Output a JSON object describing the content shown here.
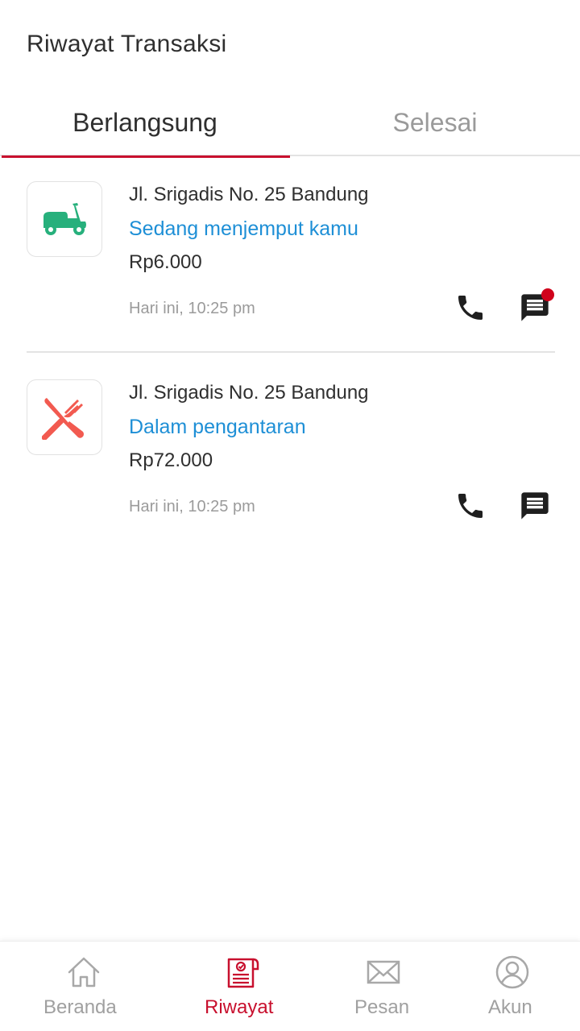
{
  "header": {
    "title": "Riwayat Transaksi"
  },
  "tabs": [
    {
      "label": "Berlangsung",
      "active": true
    },
    {
      "label": "Selesai",
      "active": false
    }
  ],
  "transactions": [
    {
      "icon": "scooter-icon",
      "address": "Jl. Srigadis No. 25 Bandung",
      "status": "Sedang menjemput kamu",
      "price": "Rp6.000",
      "time": "Hari ini, 10:25 pm",
      "has_unread_message": true
    },
    {
      "icon": "fork-knife-icon",
      "address": "Jl. Srigadis No. 25 Bandung",
      "status": "Dalam pengantaran",
      "price": "Rp72.000",
      "time": "Hari ini, 10:25 pm",
      "has_unread_message": false
    }
  ],
  "bottom_nav": [
    {
      "label": "Beranda",
      "icon": "home-icon",
      "active": false
    },
    {
      "label": "Riwayat",
      "icon": "history-icon",
      "active": true
    },
    {
      "label": "Pesan",
      "icon": "mail-icon",
      "active": false
    },
    {
      "label": "Akun",
      "icon": "account-icon",
      "active": false
    }
  ],
  "colors": {
    "accent": "#c8102e",
    "status_blue": "#1e8fd6",
    "ride_green": "#27b07c",
    "food_red": "#f25a50",
    "badge_red": "#d0021b"
  }
}
